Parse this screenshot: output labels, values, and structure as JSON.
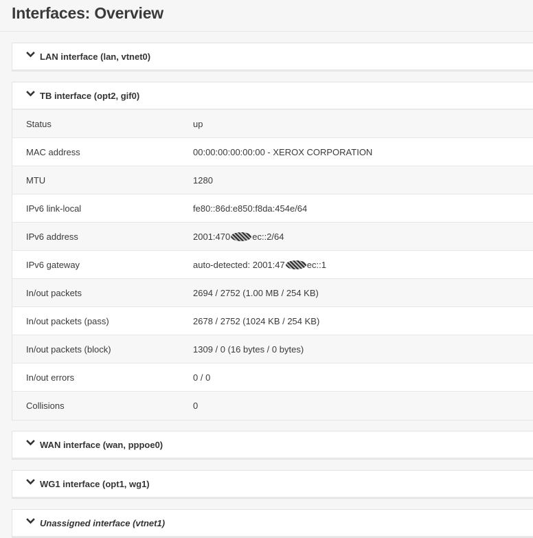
{
  "page": {
    "title": "Interfaces: Overview"
  },
  "panels": [
    {
      "title": "LAN interface (lan, vtnet0)",
      "italic": false,
      "expanded": false
    },
    {
      "title": "TB interface (opt2, gif0)",
      "italic": false,
      "expanded": true
    },
    {
      "title": "WAN interface (wan, pppoe0)",
      "italic": false,
      "expanded": false
    },
    {
      "title": "WG1 interface (opt1, wg1)",
      "italic": false,
      "expanded": false
    },
    {
      "title": "Unassigned interface (vtnet1)",
      "italic": true,
      "expanded": false
    }
  ],
  "tb_details": [
    {
      "label": "Status",
      "value": "up"
    },
    {
      "label": "MAC address",
      "value": "00:00:00:00:00:00 - XEROX CORPORATION"
    },
    {
      "label": "MTU",
      "value": "1280"
    },
    {
      "label": "IPv6 link-local",
      "value": "fe80::86d:e850:f8da:454e/64"
    },
    {
      "label": "IPv6 address",
      "value_prefix": "2001:470",
      "value_suffix": "ec::2/64"
    },
    {
      "label": "IPv6 gateway",
      "value_prefix": "auto-detected: 2001:47",
      "value_suffix": "ec::1"
    },
    {
      "label": "In/out packets",
      "value": "2694 / 2752 (1.00 MB / 254 KB)"
    },
    {
      "label": "In/out packets (pass)",
      "value": "2678 / 2752 (1024 KB / 254 KB)"
    },
    {
      "label": "In/out packets (block)",
      "value": "1309 / 0 (16 bytes / 0 bytes)"
    },
    {
      "label": "In/out errors",
      "value": "0 / 0"
    },
    {
      "label": "Collisions",
      "value": "0"
    }
  ],
  "icons": {
    "panel_toggle": "chevron-down-icon"
  },
  "colors": {
    "background": "#f6f6f6",
    "panel": "#ffffff",
    "border": "#e3e3e3",
    "text": "#333333"
  }
}
